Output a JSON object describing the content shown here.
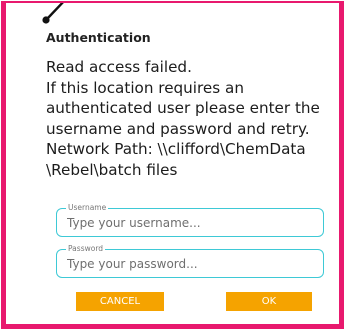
{
  "dialog": {
    "title": "Authentication",
    "message_lines": [
      "Read access failed.",
      "If this location requires an",
      "authenticated user please enter the",
      "username and password and retry.",
      "Network Path: \\\\clifford\\ChemData",
      "\\Rebel\\batch files"
    ]
  },
  "fields": {
    "username": {
      "label": "Username",
      "value": "",
      "placeholder": "Type your username..."
    },
    "password": {
      "label": "Password",
      "value": "",
      "placeholder": "Type your password..."
    }
  },
  "buttons": {
    "cancel_label": "CANCEL",
    "ok_label": "OK"
  },
  "colors": {
    "border": "#e8196e",
    "field_border": "#3ec9d6",
    "button": "#f5a300",
    "button_text": "#ffffff",
    "corner_mark": "#111111"
  },
  "icons": {
    "corner_mark": "pointer-stroke-icon"
  }
}
